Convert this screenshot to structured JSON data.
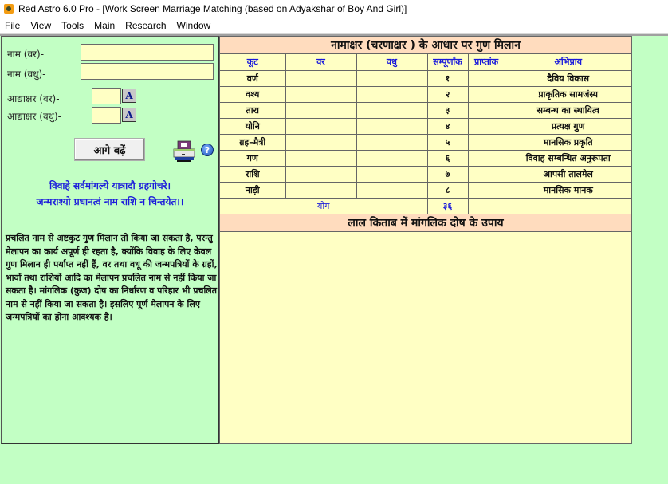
{
  "window": {
    "title": "Red Astro 6.0 Pro - [Work Screen Marriage Matching (based on Adyakshar of Boy And Girl)]"
  },
  "menu": {
    "items": [
      "File",
      "View",
      "Tools",
      "Main",
      "Research",
      "Window"
    ]
  },
  "form": {
    "groom_name_label": "नाम (वर)-",
    "bride_name_label": "नाम (वधु)-",
    "groom_name_value": "",
    "bride_name_value": "",
    "groom_initial_label": "आद्याक्षर (वर)-",
    "bride_initial_label": "आद्याक्षर (वधु)-",
    "groom_initial_value": "",
    "bride_initial_value": "",
    "font_button_label": "A",
    "next_button_label": "आगे बढ़ें",
    "help_label": "?"
  },
  "shloka": {
    "line1": "विवाहे सर्वमांगल्ये यात्रादौ ग्रहगोचरे।",
    "line2": "जन्मराश्यो प्रधानत्वं नाम राशि न चिन्तयेत।।"
  },
  "note": "प्रचलित नाम से अष्टकुट गुण मिलान तो किया जा सकता है, परन्तु मेलापन का कार्य अपूर्ण ही रहता है, क्योंकि विवाह के लिए केवल गुण मिलान ही पर्याप्त नहीं हैं, वर तथा वधू की जन्मपत्रियों के ग्रहों, भावों तथा राशियों आदि का मेलापन प्रचलित नाम से नहीं किया जा सकता है। मांगलिक (कुज) दोष का निर्धारण व परिहार भी प्रचलित नाम से नहीं किया जा सकता है। इसलिए पूर्ण मेलापन के लिए जन्मपत्रियों का होना आवश्यक है।",
  "guna_table": {
    "title": "नामाक्षर (चरणाक्षर ) के आधार पर गुण मिलान",
    "headers": [
      "कूट",
      "वर",
      "वधु",
      "सम्पूर्णांक",
      "प्राप्तांक",
      "अभिप्राय"
    ],
    "rows": [
      {
        "koot": "वर्ण",
        "var": "",
        "vadhu": "",
        "total": "१",
        "obtained": "",
        "meaning": "दैविय विकास"
      },
      {
        "koot": "वश्य",
        "var": "",
        "vadhu": "",
        "total": "२",
        "obtained": "",
        "meaning": "प्राकृतिक सामजंस्य"
      },
      {
        "koot": "तारा",
        "var": "",
        "vadhu": "",
        "total": "३",
        "obtained": "",
        "meaning": "सम्बन्ध का स्थायित्व"
      },
      {
        "koot": "योनि",
        "var": "",
        "vadhu": "",
        "total": "४",
        "obtained": "",
        "meaning": "प्रत्यक्ष गुण"
      },
      {
        "koot": "ग्रह–मैत्री",
        "var": "",
        "vadhu": "",
        "total": "५",
        "obtained": "",
        "meaning": "मानसिक प्रकृति"
      },
      {
        "koot": "गण",
        "var": "",
        "vadhu": "",
        "total": "६",
        "obtained": "",
        "meaning": "विवाह सम्बन्धित अनुरूपता"
      },
      {
        "koot": "राशि",
        "var": "",
        "vadhu": "",
        "total": "७",
        "obtained": "",
        "meaning": "आपसी तालमेल"
      },
      {
        "koot": "नाड़ी",
        "var": "",
        "vadhu": "",
        "total": "८",
        "obtained": "",
        "meaning": "मानसिक मानक"
      }
    ],
    "total_label": "योग",
    "total_value": "३६",
    "total_obtained": ""
  },
  "remedy": {
    "title": "लाल किताब में मांगलिक दोष के उपाय",
    "content": ""
  },
  "colors": {
    "background": "#c2ffc4",
    "panel": "#ffffc4",
    "header": "#ffdcbe",
    "accent_text": "#1a1adb"
  }
}
